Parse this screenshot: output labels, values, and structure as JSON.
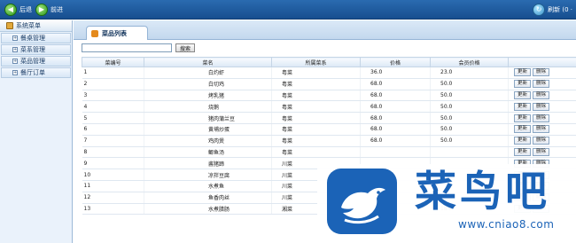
{
  "toolbar": {
    "back_label": "后退",
    "forward_label": "前进",
    "refresh_label": "刷新 (0 ·"
  },
  "sidebar": {
    "header": "系统菜单",
    "items": [
      {
        "label": "餐桌管理"
      },
      {
        "label": "菜系管理"
      },
      {
        "label": "菜品管理"
      },
      {
        "label": "餐厅订单"
      }
    ]
  },
  "main": {
    "tab_label": "菜品列表",
    "search": {
      "placeholder": "",
      "value": "",
      "button_label": "搜索"
    },
    "table": {
      "headers": [
        "菜编号",
        "菜名",
        "所属菜系",
        "价格",
        "会员价格",
        ""
      ],
      "update_label": "更新",
      "delete_label": "删除",
      "rows": [
        {
          "id": "1",
          "name": "白灼虾",
          "category": "粤菜",
          "price": "36.0",
          "member_price": "23.0"
        },
        {
          "id": "2",
          "name": "白切鸡",
          "category": "粤菜",
          "price": "68.0",
          "member_price": "50.0"
        },
        {
          "id": "3",
          "name": "烤乳猪",
          "category": "粤菜",
          "price": "68.0",
          "member_price": "50.0"
        },
        {
          "id": "4",
          "name": "烧鹅",
          "category": "粤菜",
          "price": "68.0",
          "member_price": "50.0"
        },
        {
          "id": "5",
          "name": "猪肉蒲兰豆",
          "category": "粤菜",
          "price": "68.0",
          "member_price": "50.0"
        },
        {
          "id": "6",
          "name": "黄埔炒蛋",
          "category": "粤菜",
          "price": "68.0",
          "member_price": "50.0"
        },
        {
          "id": "7",
          "name": "鸡肉煲",
          "category": "粤菜",
          "price": "68.0",
          "member_price": "50.0"
        },
        {
          "id": "8",
          "name": "鲫鱼汤",
          "category": "粤菜",
          "price": "",
          "member_price": ""
        },
        {
          "id": "9",
          "name": "酱猪蹄",
          "category": "川菜",
          "price": "",
          "member_price": ""
        },
        {
          "id": "10",
          "name": "凉拌豆腐",
          "category": "川菜",
          "price": "",
          "member_price": ""
        },
        {
          "id": "11",
          "name": "水煮鱼",
          "category": "川菜",
          "price": "",
          "member_price": ""
        },
        {
          "id": "12",
          "name": "鱼香肉丝",
          "category": "川菜",
          "price": "",
          "member_price": ""
        },
        {
          "id": "13",
          "name": "水煮腊肠",
          "category": "湘菜",
          "price": "23.0",
          "member_price": "18.0"
        }
      ]
    }
  },
  "watermark": {
    "title": "菜鸟吧",
    "url": "www.cniao8.com"
  },
  "colors": {
    "topbar": "#1f5c9f",
    "accent": "#1b63b7",
    "tab_icon": "#e48a1d"
  }
}
